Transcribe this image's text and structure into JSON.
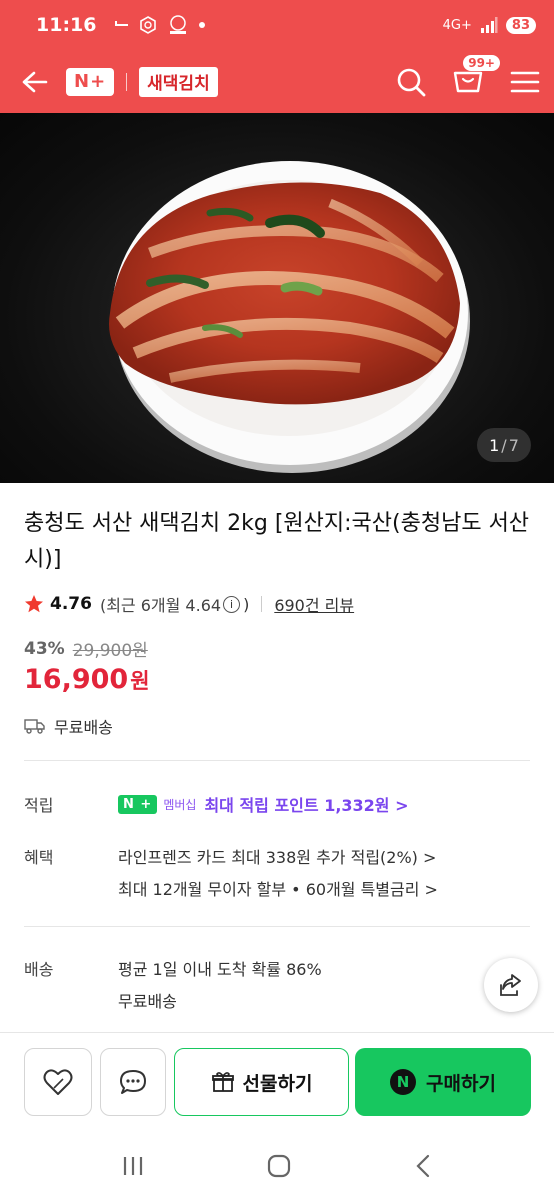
{
  "status_bar": {
    "time": "11:16",
    "network": "4G+",
    "battery": "83",
    "notification_icons": [
      "dash-icon",
      "cube-icon",
      "sol-bank-icon",
      "dot-icon"
    ]
  },
  "header": {
    "brand": "N+",
    "store_name": "새댁김치",
    "cart_badge": "99+",
    "accent_color": "#ee4d4d"
  },
  "gallery": {
    "current": "1",
    "separator": "/",
    "total": "7"
  },
  "product": {
    "title": "충청도 서산 새댁김치 2kg [원산지:국산(충청남도 서산시)]",
    "rating": "4.76",
    "recent_rating_open": "(최근 6개월 4.64",
    "recent_rating_close": ")",
    "info_glyph": "i",
    "review_count": "690건 리뷰",
    "discount": "43%",
    "original_price": "29,900원",
    "price": "16,900",
    "price_unit": "원",
    "shipping": "무료배송",
    "price_color": "#e2253a"
  },
  "details": {
    "reward_label": "적립",
    "membership_badge": "N + ",
    "membership_text": "멤버십",
    "membership_point": "최대 적립 포인트 1,332원 >",
    "benefit_label": "혜택",
    "benefit_card": "라인프렌즈 카드 최대 338원 추가 적립(2%) >",
    "benefit_installment": "최대 12개월 무이자 할부 • 60개월 특별금리 >",
    "delivery_label": "배송",
    "delivery_probability": "평균 1일 이내 도착 확률 86%",
    "delivery_fee": "무료배송"
  },
  "actions": {
    "gift_label": "선물하기",
    "buy_label": "구매하기",
    "buy_badge": "N",
    "buy_color": "#17c75f"
  }
}
